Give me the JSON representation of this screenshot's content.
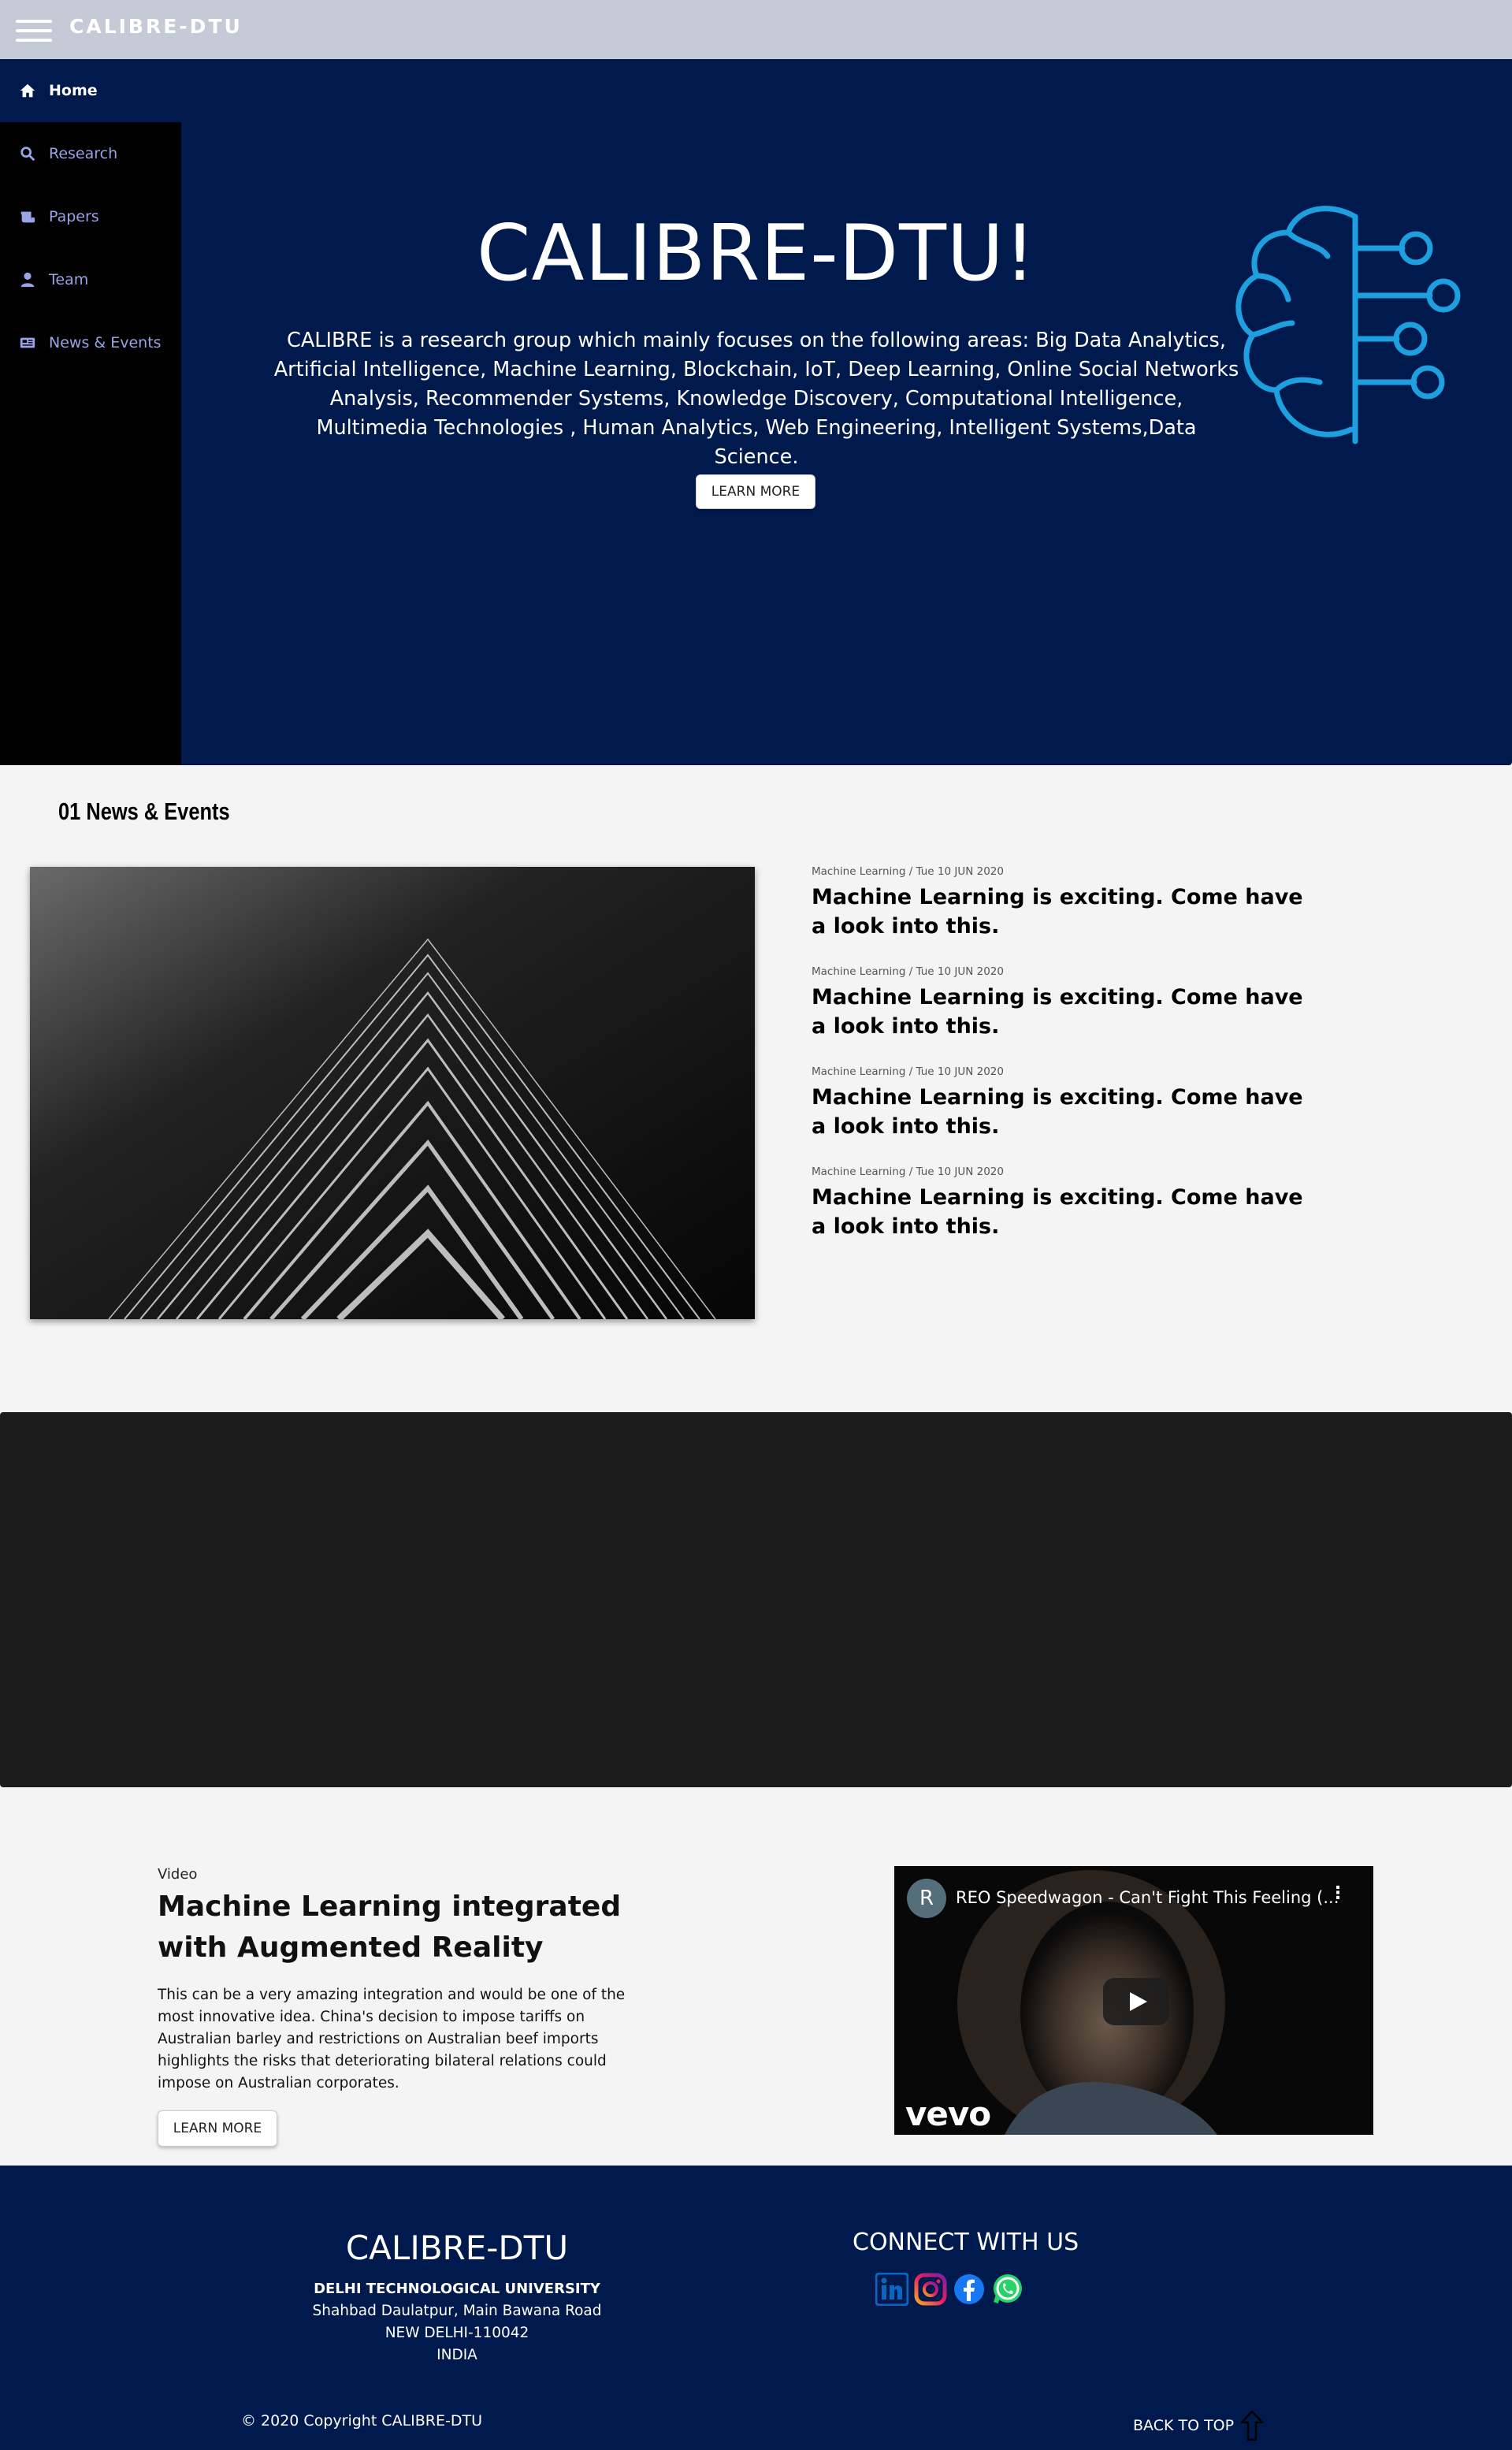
{
  "app": {
    "brand": "CALIBRE-DTU"
  },
  "sidebar": {
    "items": [
      {
        "label": "Home",
        "icon": "home-icon",
        "active": true
      },
      {
        "label": "Research",
        "icon": "search-icon"
      },
      {
        "label": "Papers",
        "icon": "scroll-icon"
      },
      {
        "label": "Team",
        "icon": "user-icon"
      },
      {
        "label": "News & Events",
        "icon": "newspaper-icon"
      }
    ]
  },
  "hero": {
    "title": "CALIBRE-DTU!",
    "description": "CALIBRE is a research group which mainly focuses on the following areas: Big Data Analytics, Artificial Intelligence, Machine Learning, Blockchain, IoT, Deep Learning, Online Social Networks Analysis, Recommender Systems, Knowledge Discovery, Computational Intelligence, Multimedia Technologies , Human Analytics, Web Engineering, Intelligent Systems,Data Science.",
    "button_label": "LEARN MORE",
    "accent_color": "#1ea0e0"
  },
  "news": {
    "heading": "01 News & Events",
    "items": [
      {
        "meta": "Machine Learning / Tue 10 JUN 2020",
        "title": "Machine Learning is exciting. Come have a look into this."
      },
      {
        "meta": "Machine Learning / Tue 10 JUN 2020",
        "title": "Machine Learning is exciting. Come have a look into this."
      },
      {
        "meta": "Machine Learning / Tue 10 JUN 2020",
        "title": "Machine Learning is exciting. Come have a look into this."
      },
      {
        "meta": "Machine Learning / Tue 10 JUN 2020",
        "title": "Machine Learning is exciting. Come have a look into this."
      }
    ]
  },
  "video_section": {
    "label": "Video",
    "title": "Machine Learning integrated with Augmented Reality",
    "description": "This can be a very amazing integration and would be one of the most innovative idea. China's decision to impose tariffs on Australian barley and restrictions on Australian beef imports highlights the risks that deteriorating bilateral relations could impose on Australian corporates.",
    "button_label": "LEARN MORE",
    "player": {
      "avatar_letter": "R",
      "title": "REO Speedwagon - Can't Fight This Feeling (...",
      "watermark": "vevo"
    }
  },
  "footer": {
    "brand": "CALIBRE-DTU",
    "university": "DELHI TECHNOLOGICAL UNIVERSITY",
    "address_line1": "Shahbad Daulatpur, Main Bawana Road",
    "address_line2": "NEW DELHI-110042",
    "country": "INDIA",
    "connect_heading": "CONNECT WITH US",
    "social": [
      "linkedin-icon",
      "instagram-icon",
      "facebook-icon",
      "whatsapp-icon"
    ],
    "copyright": "© 2020 Copyright CALIBRE-DTU",
    "back_to_top": "BACK TO TOP"
  },
  "colors": {
    "navy": "#001a4e",
    "sidebar": "#000000",
    "sidebar_link": "#9aa3e6",
    "topbar": "#c5cbd6"
  }
}
